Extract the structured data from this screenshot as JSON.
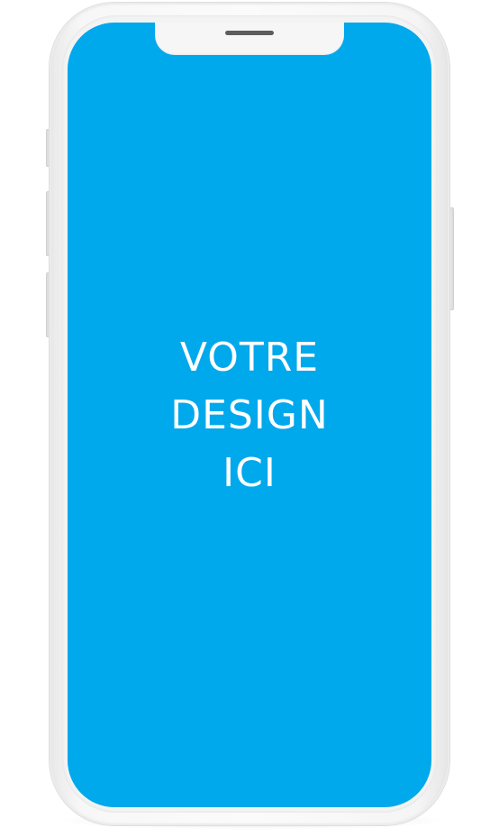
{
  "screen": {
    "placeholder_lines": [
      "VOTRE",
      "DESIGN",
      "ICI"
    ],
    "background_color": "#00a8ec",
    "text_color": "#ffffff"
  },
  "device": {
    "frame_color": "#f6f6f6"
  }
}
